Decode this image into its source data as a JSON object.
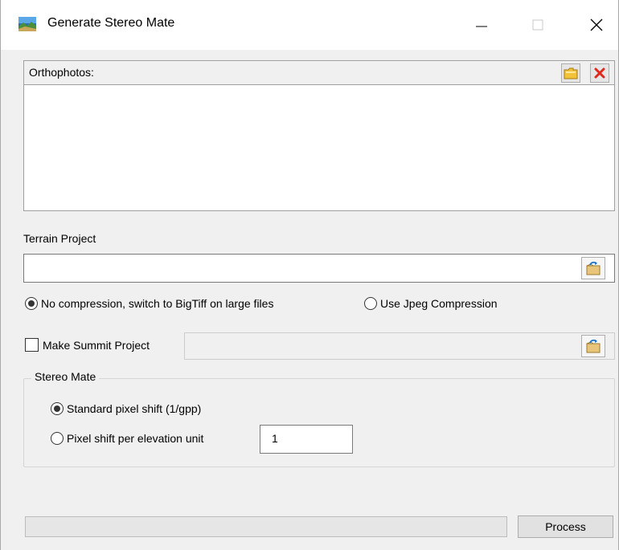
{
  "window": {
    "title": "Generate Stereo Mate",
    "app_icon": "landscape-image-icon",
    "controls": [
      "minimize-icon",
      "maximize-icon",
      "close-icon"
    ]
  },
  "orthophotos": {
    "label": "Orthophotos:",
    "buttons": [
      "folder-open-icon",
      "remove-x-icon"
    ],
    "items": []
  },
  "terrain": {
    "label": "Terrain Project",
    "value": "",
    "browse_icon": "browse-folder-icon"
  },
  "compression": {
    "options": [
      {
        "label": "No compression, switch to BigTiff on large files",
        "selected": true
      },
      {
        "label": "Use Jpeg Compression",
        "selected": false
      }
    ]
  },
  "summit": {
    "label": "Make Summit Project",
    "checked": false,
    "value": "",
    "browse_icon": "browse-folder-icon"
  },
  "stereo_mate": {
    "legend": "Stereo Mate",
    "options": [
      {
        "label": "Standard pixel shift (1/gpp)",
        "selected": true
      },
      {
        "label": "Pixel shift per elevation unit",
        "selected": false
      }
    ],
    "shift_value": "1"
  },
  "footer": {
    "progress": 0,
    "process_label": "Process"
  },
  "colors": {
    "accent_remove": "#e0291c",
    "folder_yellow": "#f2c23a"
  }
}
